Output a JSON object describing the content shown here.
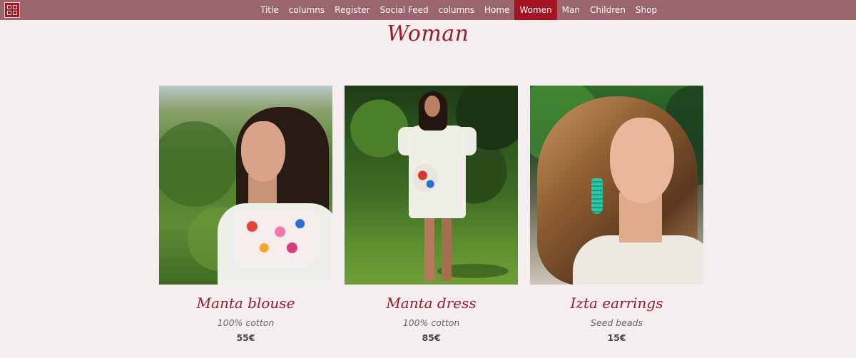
{
  "nav": {
    "items": [
      {
        "label": "Title",
        "active": false
      },
      {
        "label": "columns",
        "active": false
      },
      {
        "label": "Register",
        "active": false
      },
      {
        "label": "Social Feed",
        "active": false
      },
      {
        "label": "columns",
        "active": false
      },
      {
        "label": "Home",
        "active": false
      },
      {
        "label": "Women",
        "active": true
      },
      {
        "label": "Man",
        "active": false
      },
      {
        "label": "Children",
        "active": false
      },
      {
        "label": "Shop",
        "active": false
      }
    ],
    "bar_color": "#9a656d",
    "active_color": "#a51422"
  },
  "page": {
    "title": "Woman",
    "accent_color": "#9c1b2a",
    "background": "#f4eeee"
  },
  "products": [
    {
      "name": "Manta blouse",
      "material": "100% cotton",
      "price": "55€"
    },
    {
      "name": "Manta dress",
      "material": "100% cotton",
      "price": "85€"
    },
    {
      "name": "Izta earrings",
      "material": "Seed beads",
      "price": "15€"
    }
  ]
}
